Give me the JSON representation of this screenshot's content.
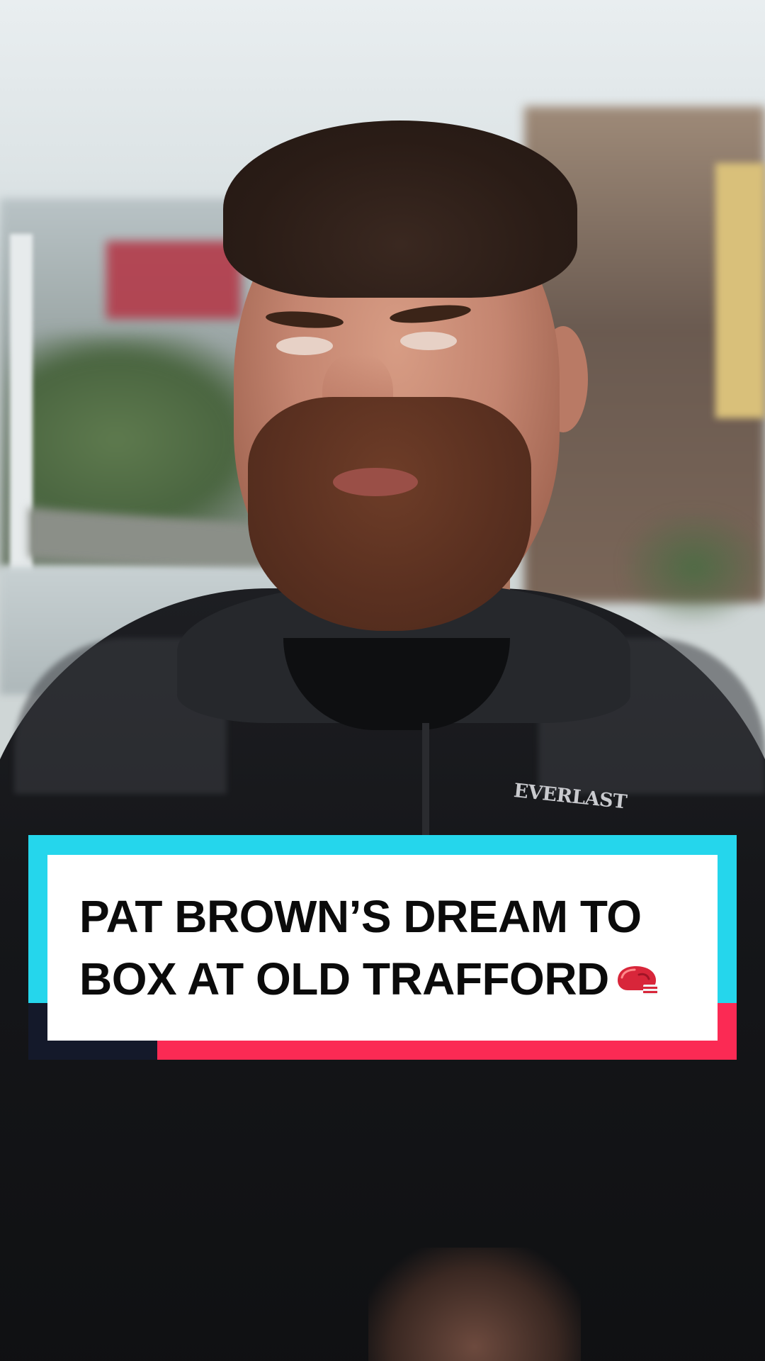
{
  "caption": {
    "line1": "PAT BROWN’S DREAM TO",
    "line2": "BOX AT OLD TRAFFORD",
    "emoji_icon": "boxing-glove-icon"
  },
  "shirt_logo": "EVERLAST",
  "colors": {
    "frame_cyan": "#25d6ec",
    "frame_red": "#fb2a54",
    "frame_navy": "#14192a",
    "caption_bg": "#ffffff",
    "caption_text": "#0b0b0b"
  }
}
